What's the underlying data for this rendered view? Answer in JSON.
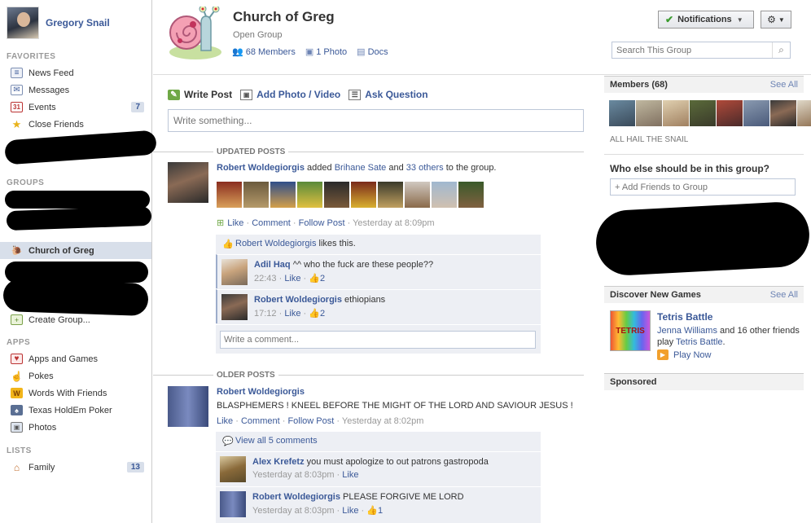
{
  "sidebar": {
    "profile_name": "Gregory Snail",
    "favorites_title": "FAVORITES",
    "favorites": [
      {
        "label": "News Feed",
        "icon": "news-feed-icon"
      },
      {
        "label": "Messages",
        "icon": "messages-icon"
      },
      {
        "label": "Events",
        "icon": "calendar-icon",
        "count": "7"
      },
      {
        "label": "Close Friends",
        "icon": "star-icon"
      }
    ],
    "groups_title": "GROUPS",
    "selected_group": "Church of Greg",
    "create_group": "Create Group...",
    "apps_title": "APPS",
    "apps": [
      {
        "label": "Apps and Games",
        "icon": "apps-icon"
      },
      {
        "label": "Pokes",
        "icon": "poke-icon"
      },
      {
        "label": "Words With Friends",
        "icon": "words-icon"
      },
      {
        "label": "Texas HoldEm Poker",
        "icon": "poker-icon"
      },
      {
        "label": "Photos",
        "icon": "photos-icon"
      }
    ],
    "lists_title": "LISTS",
    "lists": [
      {
        "label": "Family",
        "icon": "house-icon",
        "count": "13"
      }
    ]
  },
  "header": {
    "title": "Church of Greg",
    "type": "Open Group",
    "members_link": "68 Members",
    "photo_link": "1 Photo",
    "docs_link": "Docs",
    "notifications_label": "Notifications",
    "search_placeholder": "Search This Group"
  },
  "composer": {
    "tabs": [
      "Write Post",
      "Add Photo / Video",
      "Ask Question"
    ],
    "placeholder": "Write something..."
  },
  "updated_posts": {
    "heading": "UPDATED POSTS",
    "author": "Robert Woldegiorgis",
    "text_pre": "added",
    "mention": "Brihane Sate",
    "text_mid": "and",
    "others": "33 others",
    "text_post": "to the group.",
    "actions": [
      "Like",
      "Comment",
      "Follow Post"
    ],
    "timestamp": "Yesterday at 8:09pm",
    "likes_name": "Robert Woldegiorgis",
    "likes_text": "likes this.",
    "comments": [
      {
        "name": "Adil Haq",
        "text": "^^ who the fuck are these people??",
        "time": "22:43",
        "like": "Like",
        "likes": "2"
      },
      {
        "name": "Robert Woldegiorgis",
        "text": "ethiopians",
        "time": "17:12",
        "like": "Like",
        "likes": "2"
      }
    ],
    "write_comment": "Write a comment..."
  },
  "older_posts": {
    "heading": "OLDER POSTS",
    "author": "Robert Woldegiorgis",
    "text": "BLASPHEMERS ! KNEEL BEFORE THE MIGHT OF THE LORD AND SAVIOUR JESUS !",
    "actions": [
      "Like",
      "Comment",
      "Follow Post"
    ],
    "timestamp": "Yesterday at 8:02pm",
    "view_all": "View all 5 comments",
    "comments": [
      {
        "name": "Alex Krefetz",
        "text": "you must apologize to out patrons gastropoda",
        "time": "Yesterday at 8:03pm",
        "like": "Like"
      },
      {
        "name": "Robert Woldegiorgis",
        "text": "PLEASE FORGIVE ME LORD",
        "time": "Yesterday at 8:03pm",
        "like": "Like",
        "likes": "1"
      }
    ]
  },
  "right": {
    "members_heading": "Members (68)",
    "see_all": "See All",
    "tagline": "ALL HAIL THE SNAIL",
    "who_else": "Who else should be in this group?",
    "add_friends_placeholder": "+ Add Friends to Group",
    "games_heading": "Discover New Games",
    "games_see_all": "See All",
    "game_title": "Tetris Battle",
    "game_friend": "Jenna Williams",
    "game_desc_mid": "and 16 other friends play",
    "game_link": "Tetris Battle",
    "game_desc_end": ".",
    "play_now": "Play Now",
    "sponsored": "Sponsored"
  },
  "colors": {
    "link": "#3b5998",
    "nav_selected": "#d8dfea",
    "ufi_bg": "#edeff4"
  }
}
